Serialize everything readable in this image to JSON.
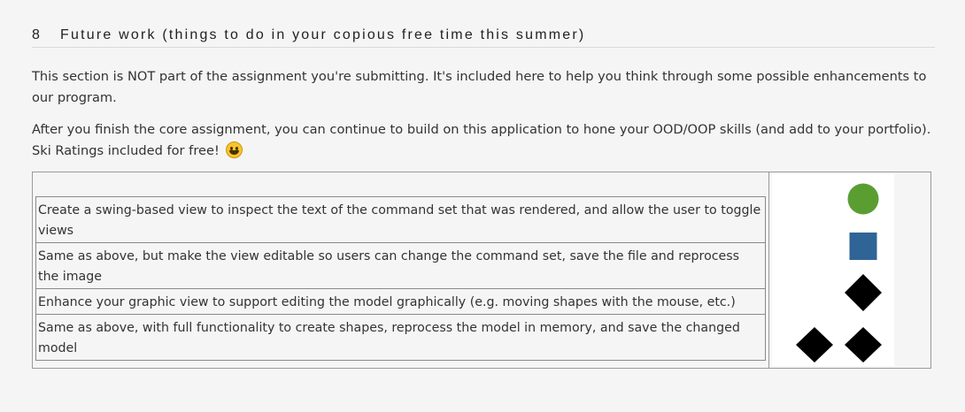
{
  "section": {
    "number": "8",
    "title": "Future work (things to do in your copious free time this summer)"
  },
  "paragraphs": [
    "This section is NOT part of the assignment you're submitting. It's included here to help you think through some possible enhancements to our program.",
    "After you finish the core assignment, you can continue to build on this application to hone your OOD/OOP skills (and add to your portfolio). Ski Ratings included for free!"
  ],
  "emoji_icon": "grinning-face-emoji",
  "tasks": [
    "Create a swing-based view to inspect the text of the command set that was rendered, and allow the user to toggle views",
    "Same as above, but make the view editable so users can change the command set, save the file and reprocess the image",
    "Enhance your graphic view to support editing the model graphically (e.g. moving shapes with the mouse, etc.)",
    "Same as above, with full functionality to create shapes, reprocess the model in memory, and save the changed model"
  ],
  "ski_ratings": [
    {
      "icon": "green-circle-icon",
      "color": "#5a9e32"
    },
    {
      "icon": "blue-square-icon",
      "color": "#2f6496"
    },
    {
      "icon": "black-diamond-icon",
      "color": "#000000"
    },
    {
      "icon": "double-black-diamond-icon",
      "color": "#000000"
    }
  ]
}
